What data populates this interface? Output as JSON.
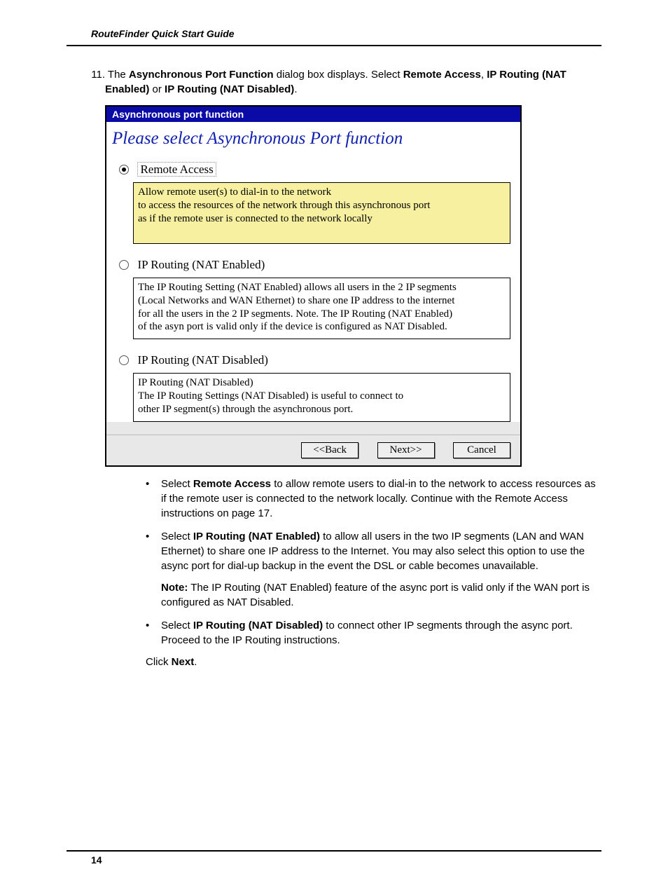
{
  "header": {
    "title": "RouteFinder Quick Start Guide"
  },
  "step": {
    "number": "11.",
    "text_parts": {
      "p1": "The ",
      "b1": "Asynchronous Port Function",
      "p2": " dialog box displays.  Select ",
      "b2": "Remote Access",
      "p3": ", ",
      "b3": "IP Routing (NAT Enabled)",
      "p4": " or ",
      "b4": "IP Routing (NAT Disabled)",
      "p5": "."
    }
  },
  "dialog": {
    "title": "Asynchronous port function",
    "heading": "Please select Asynchronous Port function",
    "options": [
      {
        "label": "Remote Access",
        "selected": true,
        "desc": "Allow remote user(s) to dial-in to the network\nto access the resources of the network through this asynchronous port\nas if the remote user is connected to the network locally"
      },
      {
        "label": "IP Routing (NAT Enabled)",
        "selected": false,
        "desc": "The IP Routing Setting (NAT Enabled) allows all users in the 2 IP segments\n(Local Networks and WAN Ethernet) to share one IP address to the internet\nfor all the users in the 2 IP segments. Note. The IP Routing (NAT Enabled)\nof the asyn port is valid only if the device is configured as NAT Disabled."
      },
      {
        "label": "IP Routing (NAT Disabled)",
        "selected": false,
        "desc": "IP Routing (NAT Disabled)\nThe IP Routing Settings (NAT Disabled) is useful to connect to\nother IP segment(s) through the asynchronous port."
      }
    ],
    "buttons": {
      "back": "<<Back",
      "next": "Next>>",
      "cancel": "Cancel"
    }
  },
  "bullets": {
    "b1": {
      "p1": "Select ",
      "bold": "Remote Access",
      "p2": " to allow remote users to dial-in to the network to access resources as if the remote user is connected to the network locally.  Continue with the Remote Access instructions on page 17."
    },
    "b2": {
      "p1": "Select ",
      "bold": "IP Routing (NAT Enabled)",
      "p2": " to allow all users in the two IP segments (LAN and WAN Ethernet) to share one IP address to the Internet.  You may also select this option to use the async port for dial-up backup in the event the DSL or cable becomes unavailable.",
      "note_b": "Note:",
      "note": " The IP Routing (NAT Enabled) feature of the async port is valid only if the WAN port is configured as NAT Disabled."
    },
    "b3": {
      "p1": "Select ",
      "bold": "IP Routing (NAT Disabled)",
      "p2": " to connect other IP segments through the async port. Proceed to the IP Routing instructions."
    }
  },
  "click_next": {
    "p1": "Click ",
    "b": "Next",
    "p2": "."
  },
  "footer": {
    "page": "14"
  }
}
